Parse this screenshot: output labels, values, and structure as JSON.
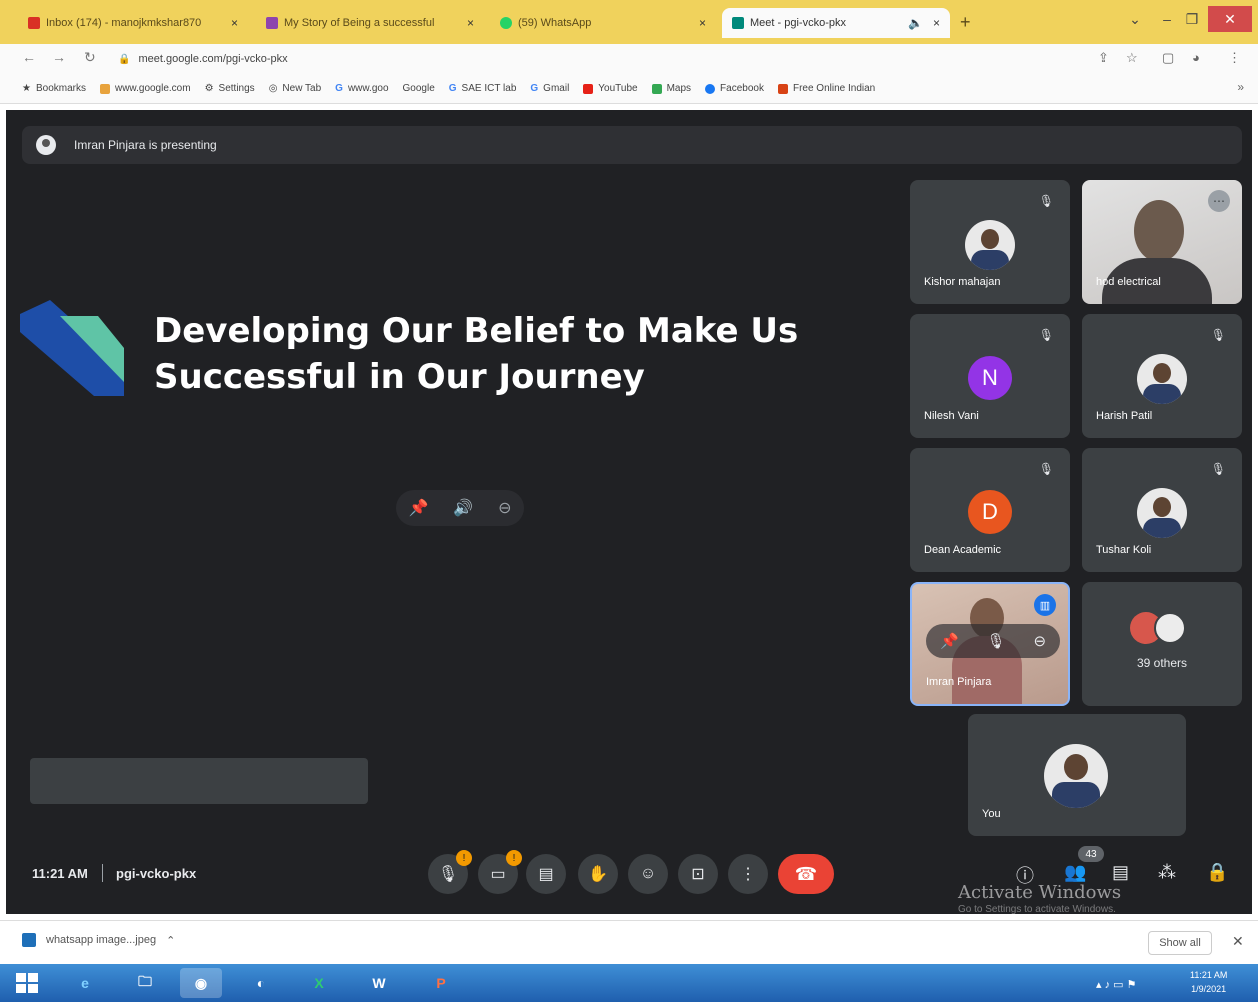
{
  "browser": {
    "tabs": [
      {
        "label": "Inbox (174) - manojkmkshar870"
      },
      {
        "label": "My Story of Being a successful"
      },
      {
        "label": "(59) WhatsApp"
      },
      {
        "label": "Meet - pgi-vcko-pkx"
      }
    ],
    "url": "meet.google.com/pgi-vcko-pkx",
    "bookmarks": [
      {
        "label": "Bookmarks"
      },
      {
        "label": "www.google.com"
      },
      {
        "label": "Settings"
      },
      {
        "label": "New Tab"
      },
      {
        "label": "www.goo"
      },
      {
        "label": "Google"
      },
      {
        "label": "SAE ICT lab"
      },
      {
        "label": "Gmail"
      },
      {
        "label": "YouTube"
      },
      {
        "label": "Maps"
      },
      {
        "label": "Facebook"
      },
      {
        "label": "Free Online Indian"
      }
    ]
  },
  "meet": {
    "presenting_banner": "Imran Pinjara is presenting",
    "slide_title_line1": "Developing Our Belief to Make Us",
    "slide_title_line2": "Successful in Our Journey",
    "participants": [
      {
        "name": "Kishor mahajan"
      },
      {
        "name": "hod electrical"
      },
      {
        "name": "Nilesh Vani",
        "initial": "N",
        "color": "#9334e6"
      },
      {
        "name": "Harish Patil"
      },
      {
        "name": "Dean Academic",
        "initial": "D",
        "color": "#e8561f"
      },
      {
        "name": "Tushar Koli"
      },
      {
        "name": "Imran Pinjara"
      }
    ],
    "others_label": "39 others",
    "self_label": "You",
    "time": "11:21 AM",
    "meeting_code": "pgi-vcko-pkx",
    "people_count": "43",
    "warn_badge": "!"
  },
  "watermark": {
    "line1": "Activate Windows",
    "line2": "Go to Settings to activate Windows."
  },
  "download": {
    "file": "whatsapp image...jpeg",
    "show_all": "Show all"
  },
  "taskbar": {
    "clock_time": "11:21 AM",
    "clock_date": "1/9/2021"
  }
}
